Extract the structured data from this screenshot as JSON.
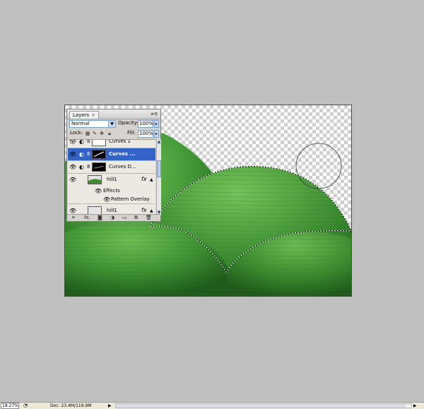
{
  "layers_panel": {
    "tab_label": "Layers",
    "tab_close": "×",
    "menu_icon": "panel-menu-icon",
    "blend_mode": "Normal",
    "opacity_label": "Opacity:",
    "opacity_value": "100%",
    "lock_label": "Lock:",
    "fill_label": "Fill:",
    "fill_value": "100%",
    "layers": [
      {
        "name": "Curves 1",
        "visible": true,
        "type": "adjustment",
        "selected": false
      },
      {
        "name": "Curves ...",
        "visible": true,
        "type": "adjustment",
        "selected": true
      },
      {
        "name": "Curves D...",
        "visible": true,
        "type": "adjustment",
        "selected": false
      },
      {
        "name": "hill1",
        "visible": true,
        "type": "pixel",
        "selected": false,
        "has_fx": true,
        "effects_label": "Effects",
        "effects": [
          "Pattern Overlay"
        ]
      },
      {
        "name": "hill1",
        "visible": true,
        "type": "pixel",
        "selected": false,
        "has_fx": true
      }
    ],
    "fx_symbol": "fx",
    "bottom_icons": [
      "link-layers-icon",
      "fx-icon",
      "mask-icon",
      "adjustment-icon",
      "group-icon",
      "new-layer-icon",
      "trash-icon"
    ]
  },
  "statusbar": {
    "zoom": "18.27%",
    "doc_info": "Doc: 23.4M/119.9M"
  },
  "colors": {
    "workspace": "#c0c0c0",
    "selection": "#3164c5",
    "hill_green": "#3a8a2e"
  }
}
